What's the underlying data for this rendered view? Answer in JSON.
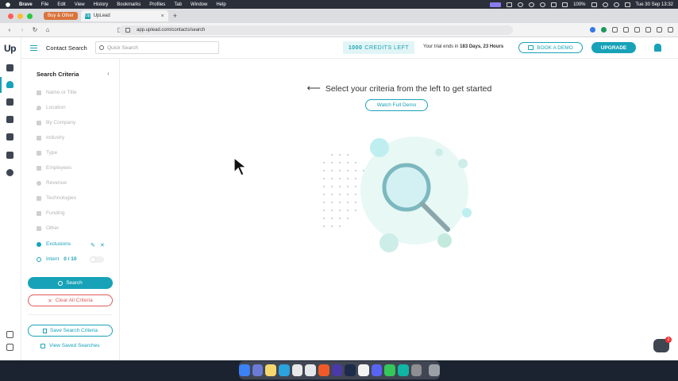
{
  "menubar": {
    "app": "Brave",
    "items": [
      "File",
      "Edit",
      "View",
      "History",
      "Bookmarks",
      "Profiles",
      "Tab",
      "Window",
      "Help"
    ],
    "battery": "100%",
    "clock": "Tue 30 Sep  13:32"
  },
  "browser": {
    "tab_group": "Buy & Other",
    "tab_title": "UpLead",
    "tab_favicon": "Up",
    "url": "app.uplead.com/contacts/search"
  },
  "header": {
    "logo": "Up",
    "title": "Contact Search",
    "quick_search_placeholder": "Quick Search",
    "credits_count": "1000",
    "credits_label": "CREDITS LEFT",
    "trial_prefix": "Your trial ends in",
    "trial_remaining": "183 Days, 23 Hours",
    "book_demo": "BOOK A DEMO",
    "upgrade": "UPGRADE"
  },
  "sidebar": {
    "title": "Search Criteria",
    "criteria": [
      "Name or Title",
      "Location",
      "By Company",
      "Industry",
      "Type",
      "Employees",
      "Revenue",
      "Technologies",
      "Funding",
      "Other"
    ],
    "exclusions": "Exclusions",
    "intent_label": "Intent",
    "intent_count": "0 / 10",
    "search_button": "Search",
    "clear_button": "Clear All Criteria",
    "save_button": "Save Search Criteria",
    "view_saved": "View Saved Searches"
  },
  "main": {
    "prompt": "Select your criteria from the left to get started",
    "watch_demo": "Watch Full Demo"
  },
  "chat": {
    "badge": "2"
  },
  "colors": {
    "accent": "#17a2b8",
    "danger": "#e05a5a"
  }
}
